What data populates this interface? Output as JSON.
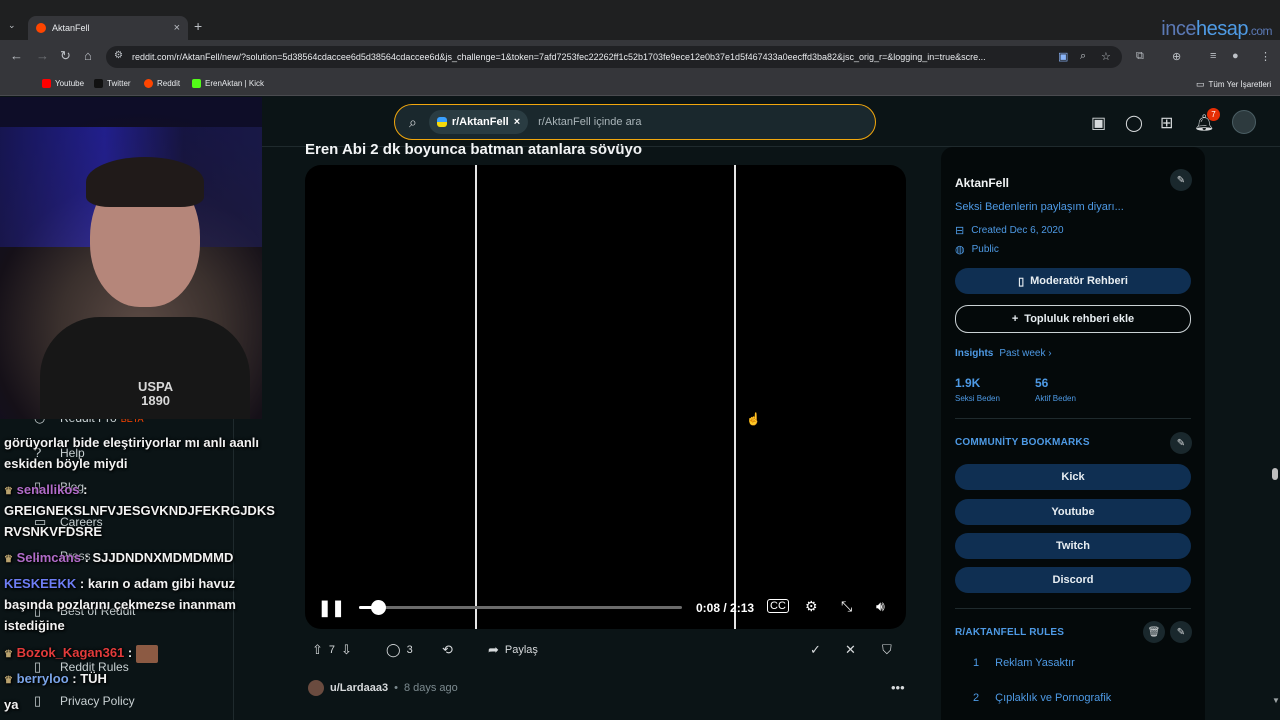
{
  "browser": {
    "tab_title": "AktanFell",
    "tab_close": "×",
    "new_tab": "+",
    "url": "reddit.com/r/AktanFell/new/?solution=5d38564cdaccee6d5d38564cdaccee6d&js_challenge=1&token=7afd7253fec22262ff1c52b1703fe9ece12e0b37e1d5f467433a0eecffd3ba82&jsc_orig_r=&logging_in=true&scre...",
    "bookmarks": [
      {
        "label": "Youtube",
        "color": "#ff0000"
      },
      {
        "label": "Twitter",
        "color": "#000000"
      },
      {
        "label": "Reddit",
        "color": "#ff4500"
      },
      {
        "label": "ErenAktan | Kick",
        "color": "#53fc18"
      }
    ],
    "all_bookmarks": "Tüm Yer İşaretleri"
  },
  "watermark": {
    "pre": "ince",
    "mid": "hesap",
    "suffix": ".com"
  },
  "header": {
    "chip_label": "r/AktanFell",
    "chip_close": "×",
    "search_placeholder": "r/AktanFell içinde ara",
    "notification_count": "7"
  },
  "left_nav": {
    "reddit_pro": "Reddit Pro",
    "beta": "BETA",
    "help": "Help",
    "blog": "Blog",
    "careers": "Careers",
    "press": "Press",
    "best_of": "Best of Reddit",
    "rules": "Reddit Rules",
    "privacy": "Privacy Policy"
  },
  "stream_overlay": {
    "shirt_logo_line1": "USPA",
    "shirt_logo_line2": "1890",
    "chat": [
      {
        "user": "",
        "text": "görüyorlar bide eleştiriyorlar mı anlı aanlı"
      },
      {
        "user": "",
        "text": "eskiden böyle miydi"
      },
      {
        "user": "senallikos",
        "text": "GREIGNEKSLNFVJESGVKNDJFEKRGJDKS"
      },
      {
        "user": "",
        "text": "RVSNKVFDSRE"
      },
      {
        "user": "Selimcans",
        "text": "SJJDNDNXMDMDMMD"
      },
      {
        "user": "KESKEEKK",
        "text": "karın o adam gibi havuz"
      },
      {
        "user": "",
        "text": "başında pozlarını çekmezse inanmam"
      },
      {
        "user": "",
        "text": "istediğine"
      },
      {
        "user": "Bozok_Kagan361",
        "text": ""
      },
      {
        "user": "berryloo",
        "text": "TÜH"
      },
      {
        "user": "",
        "text": "ya"
      }
    ]
  },
  "post": {
    "title": "Eren Abi 2 dk boyunca batman atanlara sövüyo",
    "player": {
      "time": "0:08 / 2:13",
      "progress": 0.06,
      "state": "playing"
    },
    "votes": "7",
    "comments": "3",
    "share": "Paylaş",
    "next_author": "u/Lardaaa3",
    "next_time": "8 days ago",
    "next_sep": "•"
  },
  "sidebar": {
    "name": "AktanFell",
    "description": "Seksi Bedenlerin paylaşım diyarı...",
    "created": "Created Dec 6, 2020",
    "visibility": "Public",
    "mod_guide": "Moderatör Rehberi",
    "add_guide": "Topluluk rehberi ekle",
    "insights_label": "Insights",
    "insights_period": "Past week ›",
    "stats": [
      {
        "value": "1.9K",
        "label": "Seksi Beden"
      },
      {
        "value": "56",
        "label": "Aktif Beden"
      }
    ],
    "bookmarks_heading": "COMMUNİTY BOOKMARKS",
    "bookmarks": [
      "Kick",
      "Youtube",
      "Twitch",
      "Discord"
    ],
    "rules_heading": "R/AKTANFELL RULES",
    "rules": [
      {
        "num": "1",
        "text": "Reklam Yasaktır"
      },
      {
        "num": "2",
        "text": "Çıplaklık ve Pornografik"
      }
    ]
  },
  "colors": {
    "accent_blue": "#4e9ae5",
    "search_border": "#f2a70d",
    "pill_bg": "#0f2f52",
    "badge_red": "#e62e05"
  }
}
